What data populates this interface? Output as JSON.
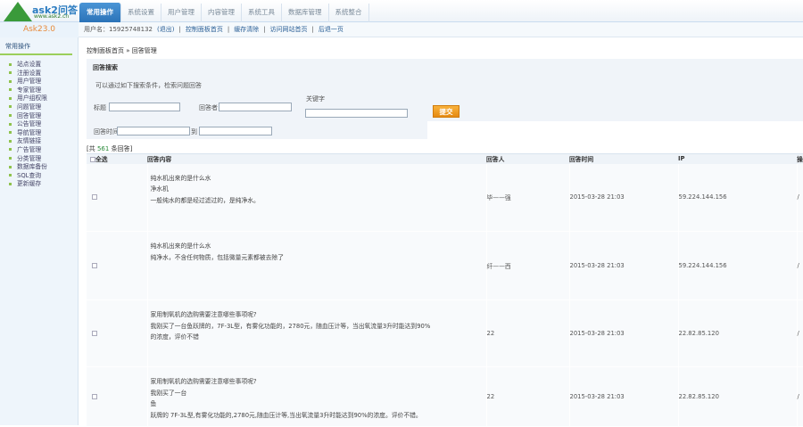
{
  "logo": {
    "name": "ask2问答",
    "url_text": "www.ask2.cn"
  },
  "version": "Ask23.0",
  "nav": {
    "tabs": [
      "常用操作",
      "系统设置",
      "用户管理",
      "内容管理",
      "系统工具",
      "数据库管理",
      "系统整合"
    ]
  },
  "subnav": {
    "user": "用户名：15925748132",
    "logout": "(退出)",
    "links": [
      "控制面板首页",
      "缓存清除",
      "访问网站首页",
      "后退一页"
    ]
  },
  "sidebar": {
    "title": "常用操作",
    "items": [
      "站点设置",
      "注册设置",
      "用户管理",
      "专家管理",
      "用户组权限",
      "问题管理",
      "回答管理",
      "公告管理",
      "导航管理",
      "友情链接",
      "广告管理",
      "分类管理",
      "数据库备份",
      "SQL查询",
      "更新缓存"
    ]
  },
  "breadcrumb": "控制面板首页 » 回答管理",
  "search": {
    "title": "回答搜索",
    "desc": "可以通过如下搜索条件，检索问题回答",
    "title_label": "标题",
    "author_label": "回答者",
    "keyword_label": "关键字",
    "submit": "提交",
    "time_label": "回答时间",
    "to_label": "到"
  },
  "count": {
    "prefix": "[共 ",
    "n": "561",
    "suffix": " 条回答]"
  },
  "table": {
    "headers": [
      "全选",
      "回答内容",
      "回答人",
      "回答时间",
      "IP",
      "操"
    ],
    "rows": [
      {
        "lines": [
          "纯水机出来的是什么水",
          "净水机",
          "一般纯水的都是经过滤过的，是纯净水。"
        ],
        "author": "毕——强",
        "time": "2015-03-28 21:03",
        "ip": "59.224.144.156",
        "op": "/"
      },
      {
        "lines": [
          "纯水机出来的是什么水",
          "纯净水，不含任何物质，包括微量元素都被去除了"
        ],
        "author": "纤——西",
        "time": "2015-03-28 21:03",
        "ip": "59.224.144.156",
        "op": "/"
      },
      {
        "lines": [
          "家用制氧机的选购需要注意哪些事项呢?",
          "我刚买了一台鱼跃牌的，7F-3L型，有雾化功能的，2780元，随血压计等，当出氧流量3升时能达到90%",
          "的浓度，评价不错"
        ],
        "author": "22",
        "time": "2015-03-28 21:03",
        "ip": "22.82.85.120",
        "op": "/"
      },
      {
        "lines": [
          "家用制氧机的选购需要注意哪些事项呢?",
          "我刚买了一台",
          "鱼",
          "跃牌的 7F-3L型,有雾化功能的,2780元,随血压计等,当出氧流量3升时能达到90%的浓度。评价不错。"
        ],
        "author": "22",
        "time": "2015-03-28 21:03",
        "ip": "22.82.85.120",
        "op": "/"
      }
    ]
  }
}
